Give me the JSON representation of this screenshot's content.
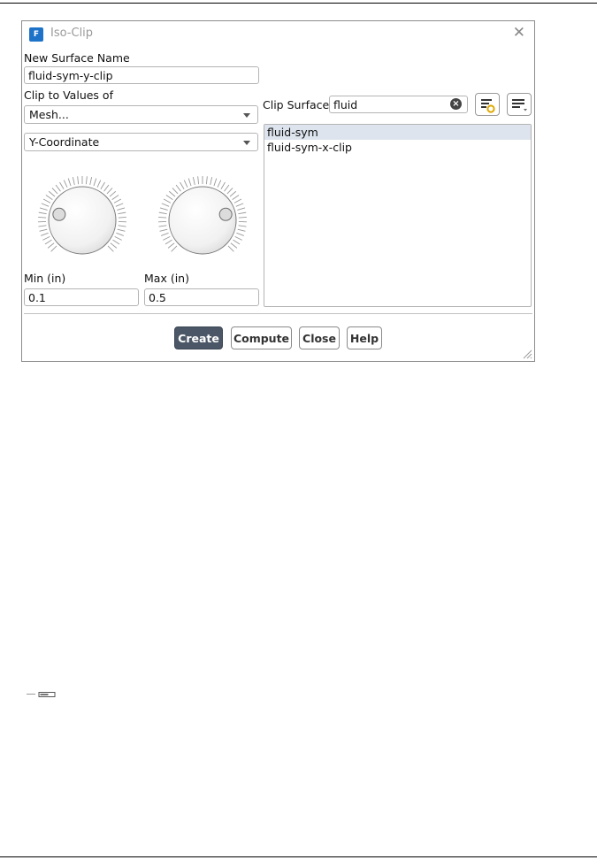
{
  "window": {
    "title": "Iso-Clip",
    "app_icon_letter": "F",
    "close_glyph": "✕"
  },
  "form": {
    "new_surface_name_label": "New Surface Name",
    "new_surface_name_value": "fluid-sym-y-clip",
    "clip_to_values_label": "Clip to Values of",
    "field_category": "Mesh...",
    "field_variable": "Y-Coordinate",
    "min_label": "Min (in)",
    "min_value": "0.1",
    "max_label": "Max (in)",
    "max_value": "0.5",
    "min_knob_fraction": 0.22,
    "max_knob_fraction": 0.78
  },
  "clip_surface": {
    "label": "Clip Surface",
    "filter_value": "fluid",
    "items": [
      {
        "label": "fluid-sym",
        "selected": true
      },
      {
        "label": "fluid-sym-x-clip",
        "selected": false
      }
    ]
  },
  "buttons": {
    "create": "Create",
    "compute": "Compute",
    "close": "Close",
    "help": "Help"
  },
  "colors": {
    "primary_button": "#4b5766",
    "selection": "#dde4ee",
    "app_icon": "#1e73c8",
    "filter_badge": "#e0a800"
  },
  "icons": {
    "app": "fluent-app-icon",
    "clear": "clear-filter-icon",
    "filter_select": "select-filter-icon",
    "list_options": "list-options-icon"
  }
}
